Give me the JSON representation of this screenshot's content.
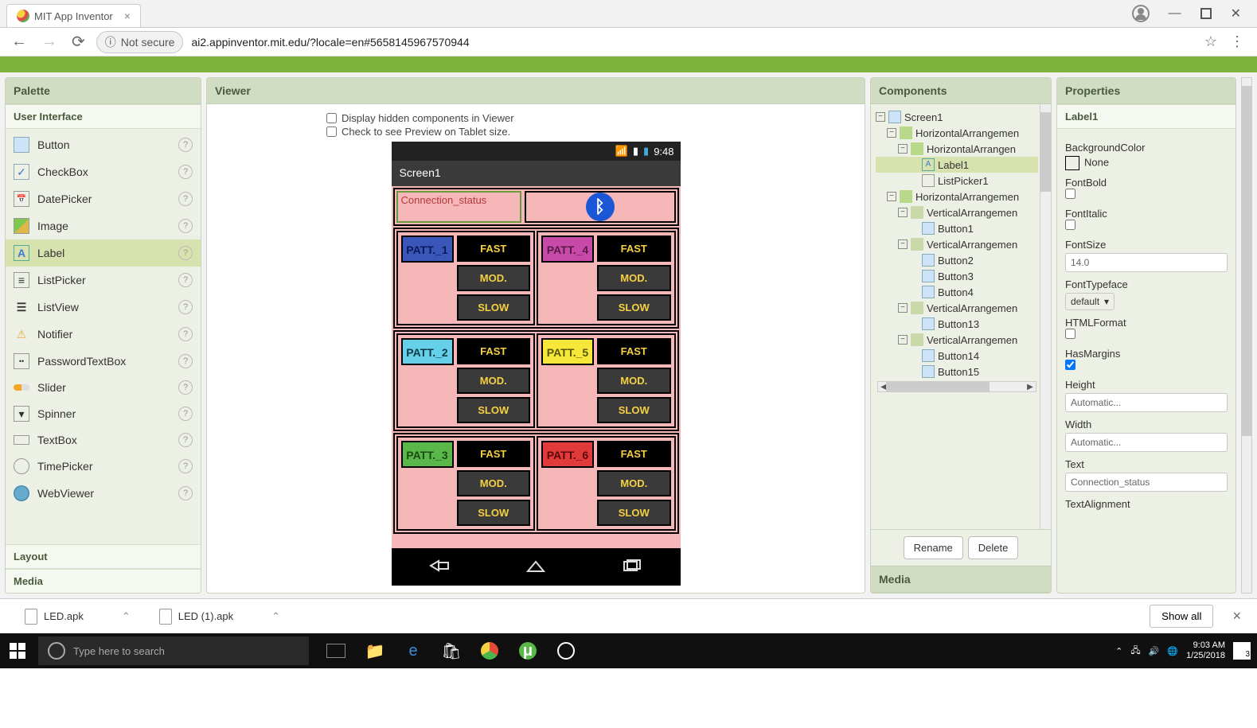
{
  "browser": {
    "tab_title": "MIT App Inventor",
    "url": "ai2.appinventor.mit.edu/?locale=en#5658145967570944",
    "security": "Not secure"
  },
  "panels": {
    "palette": "Palette",
    "viewer": "Viewer",
    "components": "Components",
    "properties": "Properties",
    "media": "Media"
  },
  "palette": {
    "ui_header": "User Interface",
    "layout_header": "Layout",
    "media_header": "Media",
    "items": [
      "Button",
      "CheckBox",
      "DatePicker",
      "Image",
      "Label",
      "ListPicker",
      "ListView",
      "Notifier",
      "PasswordTextBox",
      "Slider",
      "Spinner",
      "TextBox",
      "TimePicker",
      "WebViewer"
    ]
  },
  "viewer": {
    "hidden_check": "Display hidden components in Viewer",
    "tablet_check": "Check to see Preview on Tablet size.",
    "time": "9:48",
    "screen_title": "Screen1",
    "conn_status": "Connection_status",
    "patts": [
      "PATT._1",
      "PATT._2",
      "PATT._3",
      "PATT._4",
      "PATT._5",
      "PATT._6"
    ],
    "fast": "FAST",
    "mod": "MOD.",
    "slow": "SLOW"
  },
  "components_tree": {
    "n0": "Screen1",
    "n1": "HorizontalArrangemen",
    "n2": "HorizontalArrangen",
    "n3": "Label1",
    "n4": "ListPicker1",
    "n5": "HorizontalArrangemen",
    "n6": "VerticalArrangemen",
    "n7": "Button1",
    "n8": "VerticalArrangemen",
    "n9": "Button2",
    "n10": "Button3",
    "n11": "Button4",
    "n12": "VerticalArrangemen",
    "n13": "Button13",
    "n14": "VerticalArrangemen",
    "n15": "Button14",
    "n16": "Button15",
    "rename": "Rename",
    "delete": "Delete"
  },
  "properties": {
    "selected": "Label1",
    "BackgroundColor_label": "BackgroundColor",
    "BackgroundColor_value": "None",
    "FontBold_label": "FontBold",
    "FontItalic_label": "FontItalic",
    "FontSize_label": "FontSize",
    "FontSize_value": "14.0",
    "FontTypeface_label": "FontTypeface",
    "FontTypeface_value": "default",
    "HTMLFormat_label": "HTMLFormat",
    "HasMargins_label": "HasMargins",
    "Height_label": "Height",
    "Height_value": "Automatic...",
    "Width_label": "Width",
    "Width_value": "Automatic...",
    "Text_label": "Text",
    "Text_value": "Connection_status",
    "TextAlignment_label": "TextAlignment"
  },
  "downloads": {
    "f1": "LED.apk",
    "f2": "LED (1).apk",
    "show_all": "Show all"
  },
  "taskbar": {
    "search_placeholder": "Type here to search",
    "time": "9:03 AM",
    "date": "1/25/2018",
    "notif_count": "3"
  }
}
